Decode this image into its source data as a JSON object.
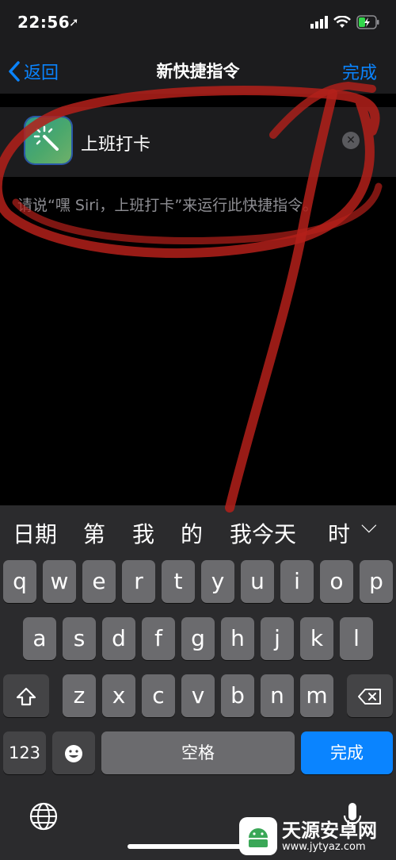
{
  "status": {
    "time": "22:56"
  },
  "nav": {
    "back_label": "返回",
    "title": "新快捷指令",
    "done_label": "完成"
  },
  "shortcut": {
    "name": "上班打卡",
    "hint": "请说“嘿 Siri，上班打卡”来运行此快捷指令。"
  },
  "keyboard": {
    "suggestions": [
      "日期",
      "第",
      "我",
      "的",
      "我今天",
      "时"
    ],
    "row1": [
      "q",
      "w",
      "e",
      "r",
      "t",
      "y",
      "u",
      "i",
      "o",
      "p"
    ],
    "row2": [
      "a",
      "s",
      "d",
      "f",
      "g",
      "h",
      "j",
      "k",
      "l"
    ],
    "row3": [
      "z",
      "x",
      "c",
      "v",
      "b",
      "n",
      "m"
    ],
    "numbers_label": "123",
    "space_label": "空格",
    "return_label": "完成"
  },
  "watermark": {
    "title": "天源安卓网",
    "url": "www.jytyaz.com"
  },
  "colors": {
    "accent": "#0a84ff",
    "annotation": "#c0221b"
  }
}
